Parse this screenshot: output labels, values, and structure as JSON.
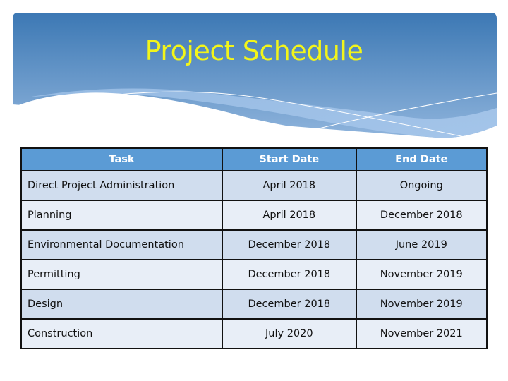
{
  "slide": {
    "title": "Project Schedule",
    "colors": {
      "title": "#f2f51a",
      "banner_top": "#3c78b4",
      "banner_bottom": "#8fb4dc",
      "table_header": "#5b9bd5",
      "row_odd": "#d0ddee",
      "row_even": "#e8eef7",
      "border": "#111111"
    }
  },
  "table": {
    "headers": [
      "Task",
      "Start Date",
      "End Date"
    ],
    "rows": [
      {
        "task": "Direct Project Administration",
        "start": "April 2018",
        "end": "Ongoing"
      },
      {
        "task": "Planning",
        "start": "April 2018",
        "end": "December 2018"
      },
      {
        "task": "Environmental Documentation",
        "start": "December 2018",
        "end": "June 2019"
      },
      {
        "task": "Permitting",
        "start": "December 2018",
        "end": "November 2019"
      },
      {
        "task": "Design",
        "start": "December 2018",
        "end": "November 2019"
      },
      {
        "task": "Construction",
        "start": "July 2020",
        "end": "November 2021"
      }
    ]
  }
}
